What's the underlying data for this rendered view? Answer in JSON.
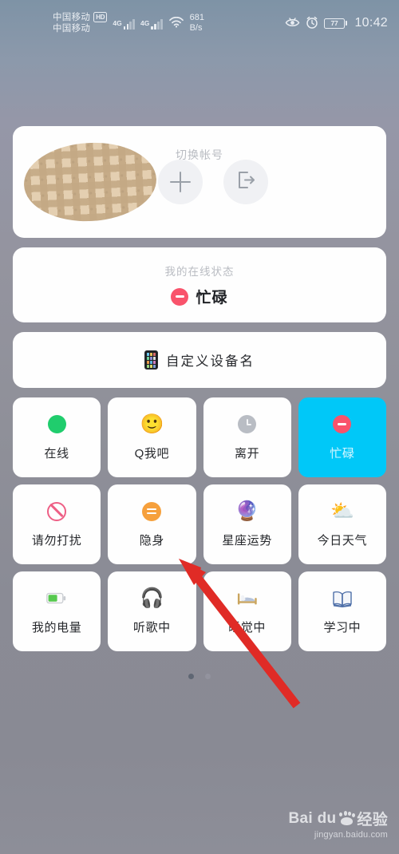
{
  "statusbar": {
    "carrier_line1": "中国移动",
    "carrier_line2": "中国移动",
    "hd_badge": "HD",
    "net1": "4G",
    "net2": "4G",
    "speed_value": "681",
    "speed_unit": "B/s",
    "battery_percent": "77",
    "clock": "10:42",
    "icons": [
      "eye-icon",
      "alarm-clock-icon",
      "battery-icon"
    ]
  },
  "account_card": {
    "switch_account_label": "切换帐号",
    "avatar_alt": "avatar",
    "add_button_label": "+",
    "logout_button_label": "logout"
  },
  "status_card": {
    "title": "我的在线状态",
    "current_status": "忙碌"
  },
  "device_card": {
    "label": "自定义设备名"
  },
  "tiles": [
    {
      "label": "在线",
      "icon": "green-circle-icon",
      "selected": false
    },
    {
      "label": "Q我吧",
      "icon": "smiley-icon",
      "selected": false
    },
    {
      "label": "离开",
      "icon": "clock-icon",
      "selected": false
    },
    {
      "label": "忙碌",
      "icon": "busy-minus-icon",
      "selected": true
    },
    {
      "label": "请勿打扰",
      "icon": "do-not-disturb-icon",
      "selected": false
    },
    {
      "label": "隐身",
      "icon": "invisible-icon",
      "selected": false
    },
    {
      "label": "星座运势",
      "icon": "crystal-ball-icon",
      "selected": false
    },
    {
      "label": "今日天气",
      "icon": "weather-sun-cloud-icon",
      "selected": false
    },
    {
      "label": "我的电量",
      "icon": "battery-green-icon",
      "selected": false
    },
    {
      "label": "听歌中",
      "icon": "headphones-icon",
      "selected": false
    },
    {
      "label": "睡觉中",
      "icon": "bed-icon",
      "selected": false
    },
    {
      "label": "学习中",
      "icon": "open-book-icon",
      "selected": false
    }
  ],
  "tile_emoji": {
    "smiley-icon": "🙂",
    "crystal-ball-icon": "🔮",
    "weather-sun-cloud-icon": "⛅",
    "battery-green-icon": "🔋",
    "headphones-icon": "🎧",
    "bed-icon": "🛏",
    "open-book-icon": "📖"
  },
  "pagination": {
    "total": 2,
    "active_index": 0
  },
  "watermark": {
    "brand": "Bai  du",
    "brand_cn": "经验",
    "url": "jingyan.baidu.com"
  },
  "annotation": {
    "type": "red-arrow",
    "points_to": "隐身"
  },
  "colors": {
    "selected_tile_bg": "#00c8f8",
    "busy_red": "#f9536b",
    "online_green": "#20cd6d",
    "invisible_orange": "#f6a03c",
    "dnd_pink": "#ee5f85",
    "arrow_red": "#e02b26",
    "card_bg": "#fefefe"
  }
}
